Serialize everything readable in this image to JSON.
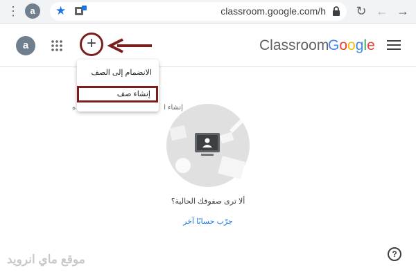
{
  "browser": {
    "profile_initial": "a",
    "url": "classroom.google.com/h",
    "icons": [
      "menu-dots-icon",
      "star-icon",
      "extension-icon",
      "lock-icon",
      "reload-icon",
      "back-icon",
      "forward-icon"
    ]
  },
  "header": {
    "avatar_initial": "a",
    "brand_part1": "Classroom",
    "brand_part2": "Google",
    "icons": [
      "apps-grid-icon",
      "plus-icon",
      "hamburger-menu-icon"
    ],
    "colors": {
      "google_blue": "#4285F4",
      "google_red": "#EA4335",
      "google_yellow": "#FBBC05",
      "google_green": "#34A853",
      "annotation": "#7b1e1e"
    }
  },
  "dropdown": {
    "join_label": "الانضمام إلى الصف",
    "create_label": "إنشاء صف"
  },
  "background": {
    "left_fragment": "ه",
    "mid_fragment": "إنشاء ا"
  },
  "empty_state": {
    "message": "ألا ترى صفوفك الحالية؟",
    "link": "جرّب حسابًا آخر"
  },
  "footer": {
    "watermark": "موقع ماي انرويد",
    "help_icon": "?"
  }
}
